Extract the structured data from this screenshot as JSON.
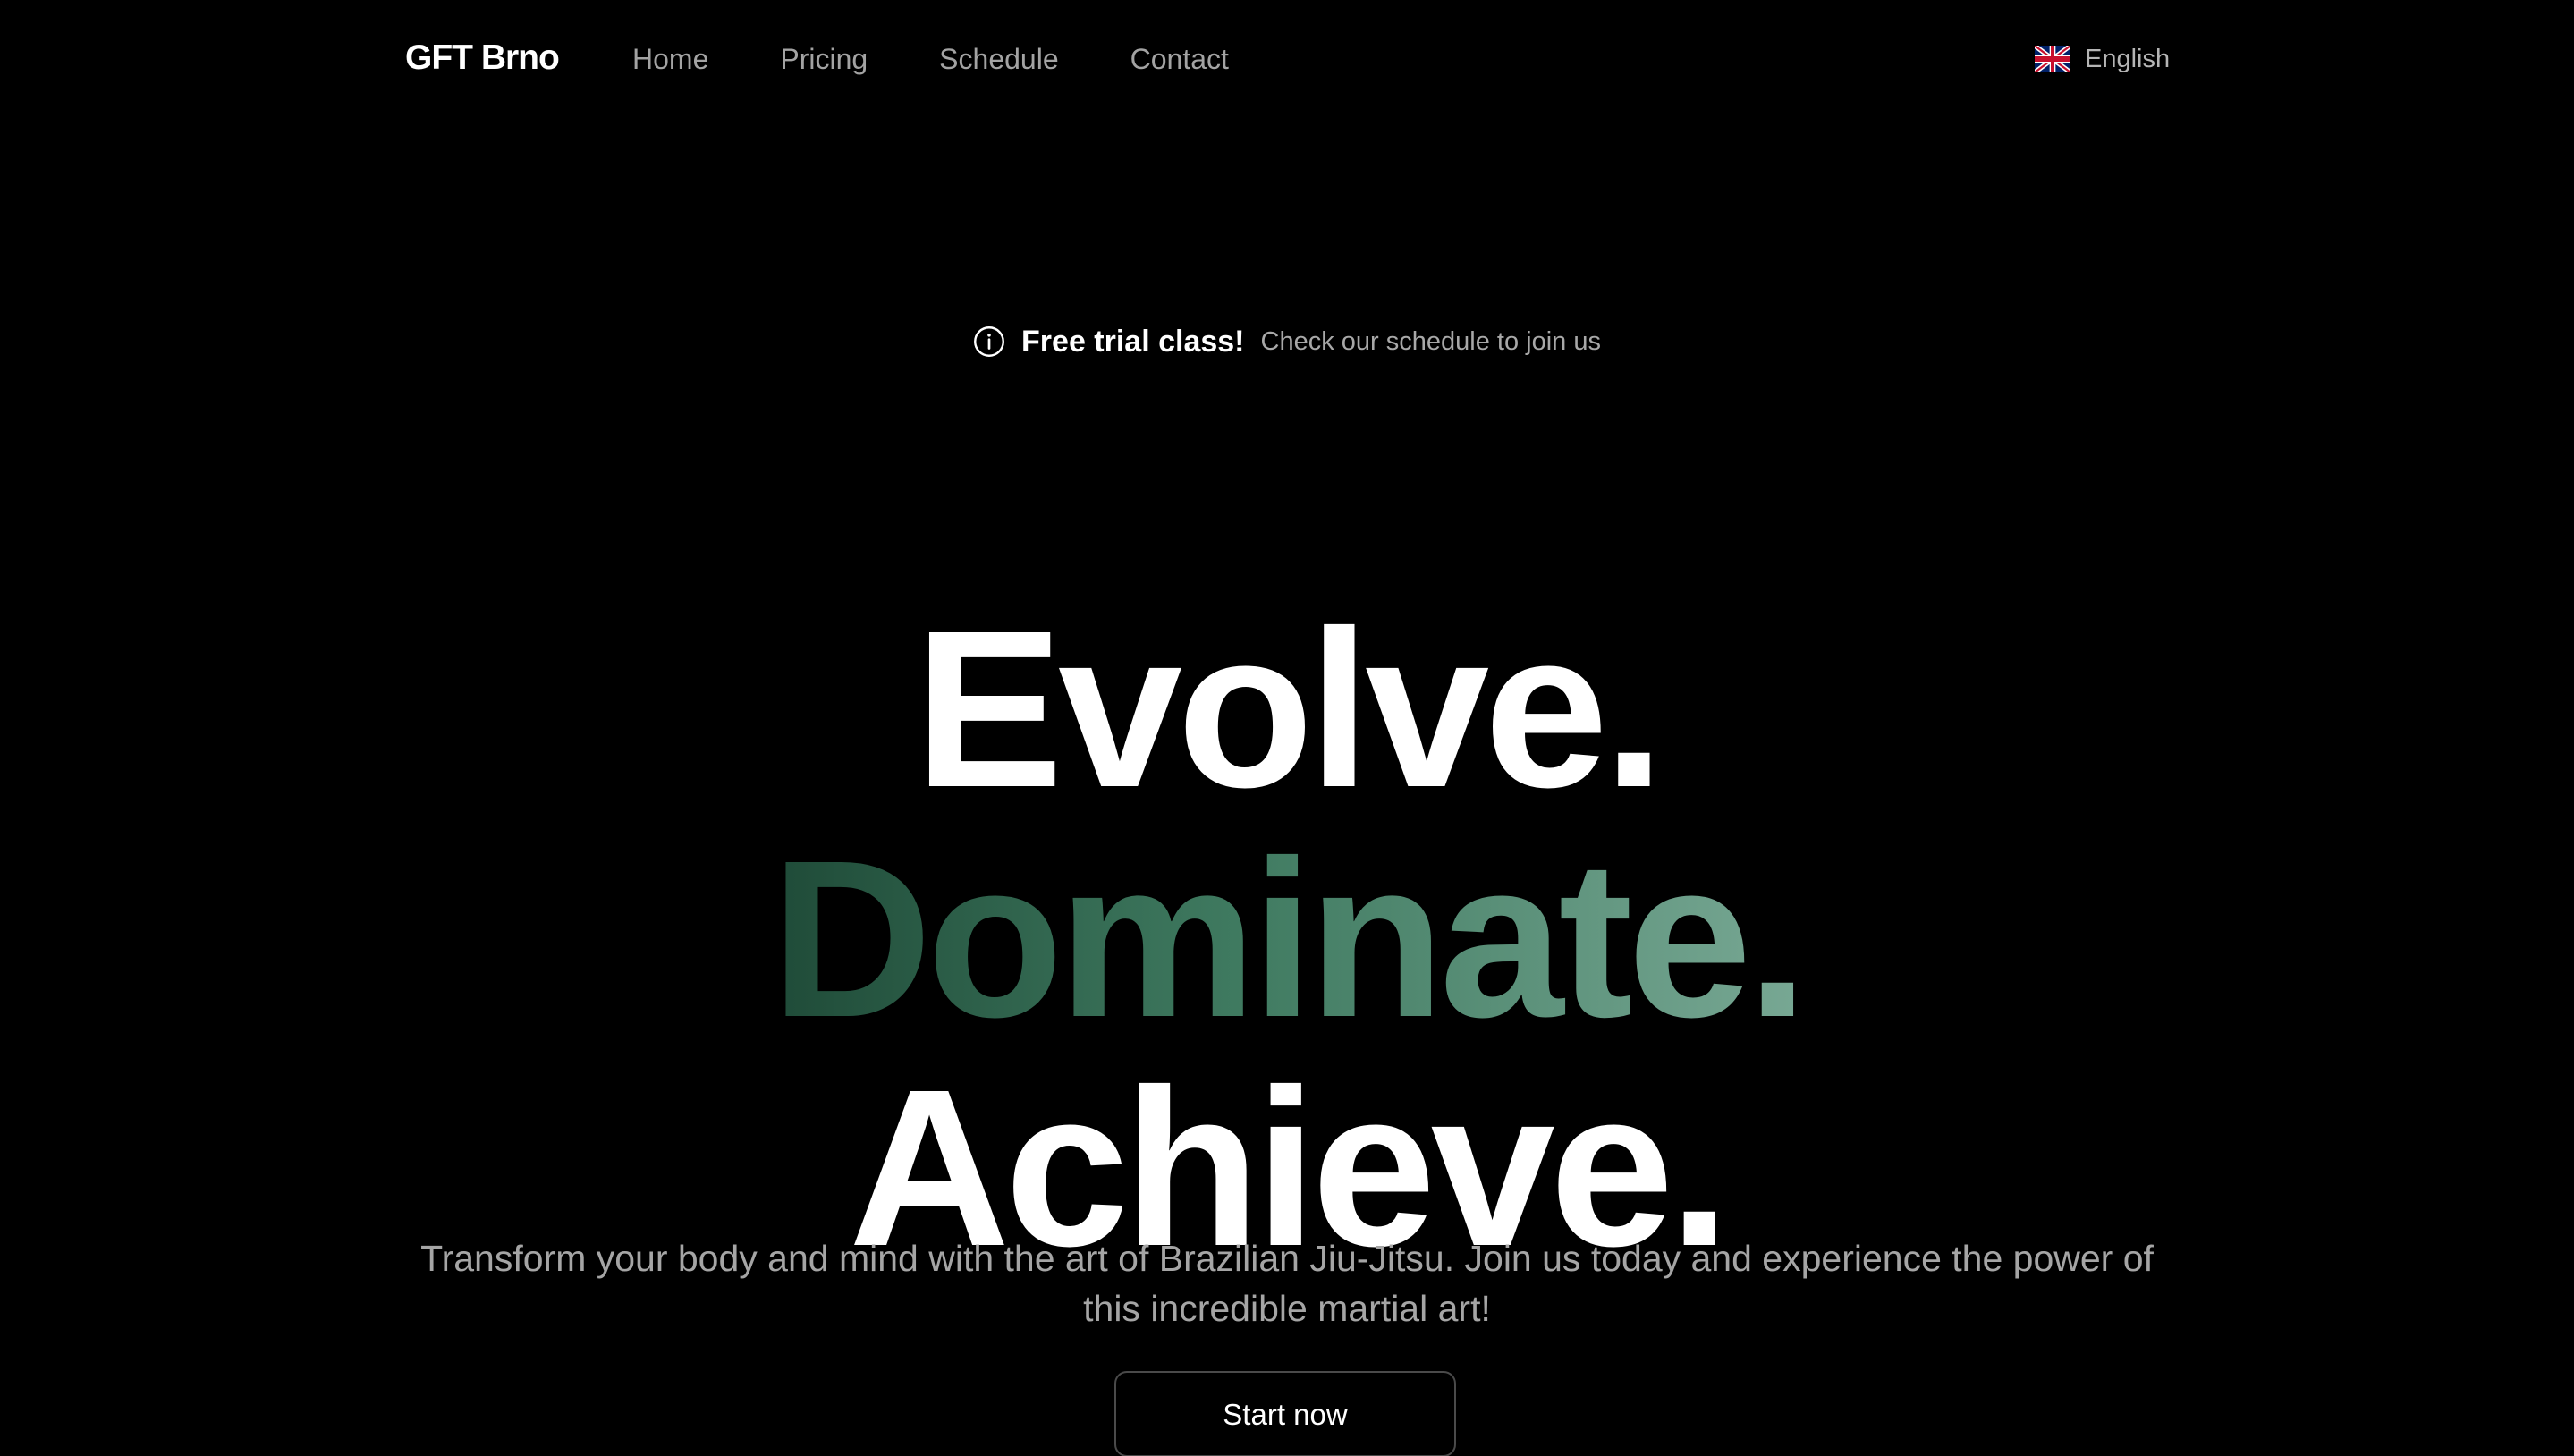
{
  "nav": {
    "brand": "GFT Brno",
    "links": [
      {
        "label": "Home"
      },
      {
        "label": "Pricing"
      },
      {
        "label": "Schedule"
      },
      {
        "label": "Contact"
      }
    ],
    "language": {
      "label": "English",
      "icon": "uk-flag-icon"
    }
  },
  "announcement": {
    "icon": "info-icon",
    "strong": "Free trial class!",
    "text": "Check our schedule to join us"
  },
  "hero": {
    "line1": "Evolve.",
    "line2": "Dominate.",
    "line3": "Achieve.",
    "subtitle": "Transform your body and mind with the art of Brazilian Jiu-Jitsu. Join us today and experience the power of this incredible martial art!",
    "cta_label": "Start now"
  },
  "colors": {
    "background": "#000000",
    "accent_gradient_start": "#1f4b38",
    "accent_gradient_end": "#78a894",
    "muted_text": "#a5a5a5"
  }
}
